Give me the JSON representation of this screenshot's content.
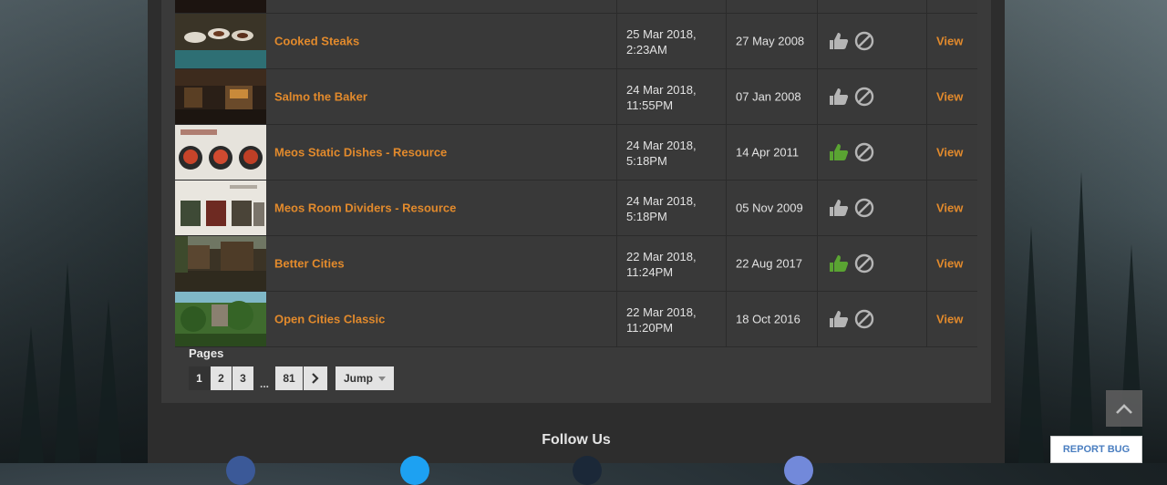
{
  "table": {
    "rows": [
      {
        "name": "Cooked Steaks",
        "updated": [
          "25 Mar 2018,",
          "2:23AM"
        ],
        "released": "27 May 2008",
        "endorsed": false
      },
      {
        "name": "Salmo the Baker",
        "updated": [
          "24 Mar 2018,",
          "11:55PM"
        ],
        "released": "07 Jan 2008",
        "endorsed": false
      },
      {
        "name": "Meos Static Dishes - Resource",
        "updated": [
          "24 Mar 2018,",
          "5:18PM"
        ],
        "released": "14 Apr 2011",
        "endorsed": true
      },
      {
        "name": "Meos Room Dividers - Resource",
        "updated": [
          "24 Mar 2018,",
          "5:18PM"
        ],
        "released": "05 Nov 2009",
        "endorsed": false
      },
      {
        "name": "Better Cities",
        "updated": [
          "22 Mar 2018,",
          "11:24PM"
        ],
        "released": "22 Aug 2017",
        "endorsed": true
      },
      {
        "name": "Open Cities Classic",
        "updated": [
          "22 Mar 2018,",
          "11:20PM"
        ],
        "released": "18 Oct 2016",
        "endorsed": false
      }
    ],
    "view_label": "View"
  },
  "pagination": {
    "label": "Pages",
    "current": "1",
    "pages": [
      "2",
      "3"
    ],
    "ellipsis": "...",
    "last": "81",
    "jump_label": "Jump"
  },
  "footer": {
    "follow_title": "Follow Us"
  },
  "report_bug_label": "REPORT BUG",
  "colors": {
    "accent": "#e28a2c",
    "endorsed": "#5aa432",
    "neutral_icon": "#b5b5b5"
  },
  "icons": [
    "thumbs-up-icon",
    "block-icon",
    "chevron-right-icon",
    "caret-down-icon",
    "arrow-up-icon"
  ]
}
